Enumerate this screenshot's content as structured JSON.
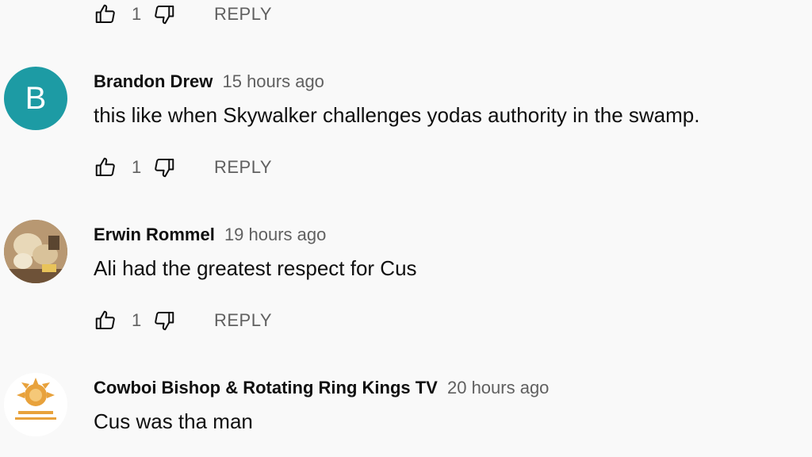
{
  "top_actions": {
    "like_count": "1",
    "reply_label": "REPLY"
  },
  "comments": [
    {
      "author": "Brandon Drew",
      "time": "15 hours ago",
      "text": "this like when Skywalker challenges yodas authority in the swamp.",
      "avatar_letter": "B",
      "avatar_color": "#1d9ba4",
      "like_count": "1",
      "reply_label": "REPLY"
    },
    {
      "author": "Erwin Rommel",
      "time": "19 hours ago",
      "text": "Ali had the greatest respect for Cus",
      "like_count": "1",
      "reply_label": "REPLY"
    },
    {
      "author": "Cowboi Bishop & Rotating Ring Kings TV",
      "time": "20 hours ago",
      "text": "Cus was tha man"
    }
  ],
  "colors": {
    "background": "#f9f9f9",
    "secondary_text": "#606060",
    "primary_text": "#0f0f0f"
  }
}
